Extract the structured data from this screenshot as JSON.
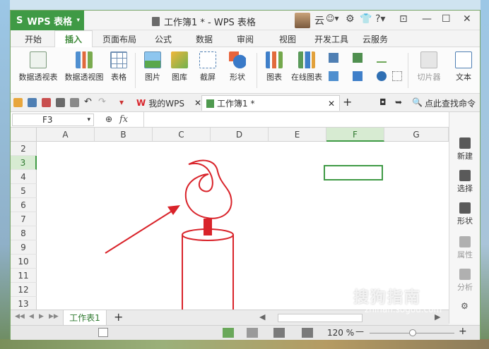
{
  "app": {
    "name": "WPS 表格",
    "window_title": "工作簿1 * - WPS 表格",
    "user_label": "云"
  },
  "menu": {
    "items": [
      "开始",
      "插入",
      "页面布局",
      "公式",
      "数据",
      "审阅",
      "视图",
      "开发工具",
      "云服务"
    ],
    "active": "插入"
  },
  "ribbon": {
    "buttons": [
      "数据透视表",
      "数据透视图",
      "表格",
      "图片",
      "图库",
      "截屏",
      "形状",
      "图表",
      "在线图表",
      "切片器",
      "文本"
    ]
  },
  "tabs": {
    "home_tab": "我的WPS",
    "doc_tab": "工作簿1 *",
    "search_label": "点此查找命令"
  },
  "formula": {
    "name_box": "F3",
    "fx": "fx",
    "value": ""
  },
  "grid": {
    "columns": [
      "A",
      "B",
      "C",
      "D",
      "E",
      "F",
      "G"
    ],
    "rows": [
      "2",
      "3",
      "4",
      "5",
      "6",
      "7",
      "8",
      "9",
      "10",
      "11",
      "12",
      "13"
    ],
    "selected_column": "F",
    "selected_row": "3"
  },
  "taskpane": {
    "items": [
      "新建",
      "选择",
      "形状",
      "属性",
      "分析"
    ]
  },
  "sheets": {
    "active": "工作表1",
    "add": "+"
  },
  "status": {
    "zoom": "120 %",
    "minus": "—",
    "plus": "+"
  },
  "watermark": {
    "text": "搜狗指南",
    "url": "zhinan.sogou.com"
  },
  "colors": {
    "accent": "#3f9a45",
    "drawing": "#d9232a"
  }
}
